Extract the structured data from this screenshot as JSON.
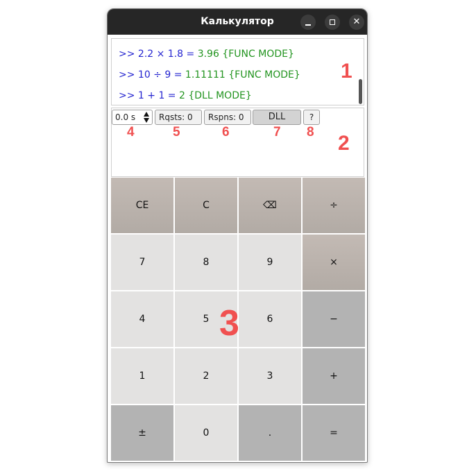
{
  "window": {
    "title": "Калькулятор"
  },
  "history": [
    {
      "expr": ">> 2.2 × 1.8 = ",
      "result": "3.96 {FUNC MODE}"
    },
    {
      "expr": ">> 10 ÷ 9 = ",
      "result": "1.11111 {FUNC MODE}"
    },
    {
      "expr": ">> 1 + 1 = ",
      "result": "2 {DLL MODE}"
    }
  ],
  "controls": {
    "delay": "0.0 s",
    "requests": "Rqsts: 0",
    "responses": "Rspns: 0",
    "mode_button": "DLL",
    "help_button": "?"
  },
  "markers": [
    "1",
    "2",
    "3",
    "4",
    "5",
    "6",
    "7",
    "8"
  ],
  "keypad": {
    "row1": [
      "CE",
      "C",
      "⌫",
      "÷"
    ],
    "row2": [
      "7",
      "8",
      "9",
      "×"
    ],
    "row3": [
      "4",
      "5",
      "6",
      "−"
    ],
    "row4": [
      "1",
      "2",
      "3",
      "+"
    ],
    "row5": [
      "±",
      "0",
      ".",
      "="
    ]
  },
  "colors": {
    "expression": "#2424d0",
    "result": "#22941f",
    "marker": "#f05050",
    "titlebar": "#262626"
  },
  "icons": {
    "backspace": "backspace-icon",
    "spin_up": "arrow-up-icon",
    "spin_down": "arrow-down-icon"
  }
}
